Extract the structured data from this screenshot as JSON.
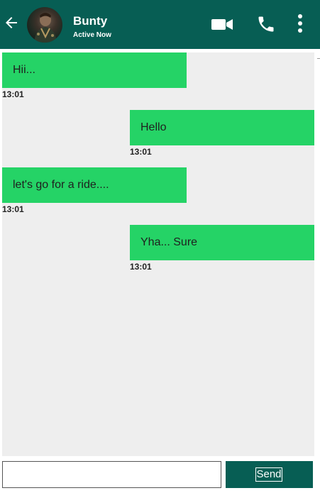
{
  "header": {
    "contact_name": "Bunty",
    "status": "Active Now",
    "icons": {
      "back": "arrow-left-icon",
      "avatar": "avatar",
      "video": "video-camera-icon",
      "call": "phone-icon",
      "menu": "more-vert-icon"
    }
  },
  "messages": [
    {
      "text": "Hii...",
      "time": "13:01",
      "direction": "incoming"
    },
    {
      "text": "Hello",
      "time": "13:01",
      "direction": "outgoing"
    },
    {
      "text": "let's go for a ride....",
      "time": "13:01",
      "direction": "incoming"
    },
    {
      "text": "Yha... Sure",
      "time": "13:01",
      "direction": "outgoing"
    }
  ],
  "composer": {
    "value": "",
    "send_label": "Send"
  },
  "colors": {
    "header_bg": "#075e54",
    "bubble_bg": "#25d366",
    "chat_bg": "#eeeeee"
  }
}
